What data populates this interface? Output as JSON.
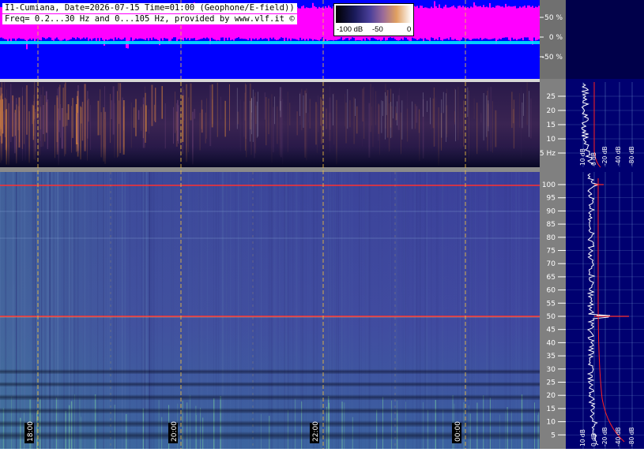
{
  "header": {
    "line1": "I1-Cumiana, Date=2026-07-15 Time=01:00 (Geophone/E-field))",
    "line2": "Freq= 0.2...30 Hz and 0...105 Hz, provided by www.vlf.it ©"
  },
  "legend": {
    "min_label": "-100 dB",
    "mid_label": "-50",
    "max_label": "0"
  },
  "amplitude_axis": {
    "labels": [
      "50 %",
      "0 %",
      "-50 %"
    ]
  },
  "low_freq_axis": {
    "labels": [
      "25",
      "20",
      "15",
      "10",
      "5 Hz"
    ]
  },
  "high_freq_axis": {
    "labels": [
      "100",
      "95",
      "90",
      "85",
      "80",
      "75",
      "70",
      "65",
      "60",
      "55",
      "50",
      "45",
      "40",
      "35",
      "30",
      "25",
      "20",
      "15",
      "10",
      "5"
    ]
  },
  "time_axis": {
    "labels": [
      "18:00",
      "20:00",
      "22:00",
      "00:00"
    ]
  },
  "spectrum_axis": {
    "labels": [
      "10 dB",
      "0 dB",
      "-20 dB",
      "-40 dB",
      "-80 dB"
    ]
  },
  "colors": {
    "amplitude_bg": "#0000ff",
    "amplitude_trace": "#ff00ff",
    "zero_trace": "#00e5ff",
    "axis_bg": "#808080",
    "spectrum_bg": "#000070",
    "cursor_line": "#f0c040",
    "mains_line": "#ff3030"
  },
  "icons": {
    "copyright": "copyright-symbol"
  }
}
